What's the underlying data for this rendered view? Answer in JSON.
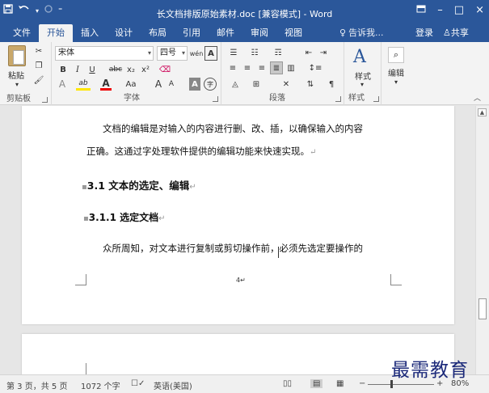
{
  "titlebar": {
    "title": "长文档排版原始素材.doc [兼容模式] - Word",
    "qat": {
      "save_icon": "save-icon",
      "undo_icon": "undo-icon",
      "redo_icon": "redo-icon",
      "customize": "⁼"
    },
    "window_controls": {
      "ribbon_display": "ribbon-display-icon",
      "minimize": "–",
      "maximize": "□",
      "close": "×"
    }
  },
  "tabs": [
    "文件",
    "开始",
    "插入",
    "设计",
    "布局",
    "引用",
    "邮件",
    "审阅",
    "视图"
  ],
  "active_tab": "开始",
  "tellme": "告诉我...",
  "login": "登录",
  "share": "共享",
  "ribbon": {
    "clipboard": {
      "paste": "粘贴",
      "label": "剪贴板"
    },
    "font": {
      "font_name": "宋体",
      "font_size": "四号",
      "wen_icon": "wén",
      "a_box": "A",
      "bold": "B",
      "italic": "I",
      "underline": "U",
      "strike": "abc",
      "sub": "x₂",
      "sup": "x²",
      "effects": "A",
      "highlight": "ab",
      "font_color": "A",
      "aa": "Aa",
      "grow": "A",
      "shrink": "A",
      "a_shade": "A",
      "enclose": "字",
      "label": "字体"
    },
    "paragraph": {
      "label": "段落"
    },
    "styles": {
      "button": "样式",
      "label": "样式"
    },
    "editing": {
      "button": "编辑"
    }
  },
  "document": {
    "para1_line1": "文档的编辑是对输入的内容进行删、改、插，以确保输入的内容",
    "para1_line2": "正确。这通过字处理软件提供的编辑功能来快速实现。",
    "heading2": "3.1  文本的选定、编辑",
    "heading3": "3.1.1  选定文档",
    "para2": "众所周知，对文本进行复制或剪切操作前，必须先选定要操作的",
    "page_number": "4",
    "para_mark": "↵"
  },
  "status": {
    "page": "第 3 页，共 5 页",
    "words": "1072 个字",
    "language": "英语(美国)",
    "zoom": "80%",
    "zoom_out": "−",
    "zoom_in": "+"
  },
  "watermark": "最需教育"
}
